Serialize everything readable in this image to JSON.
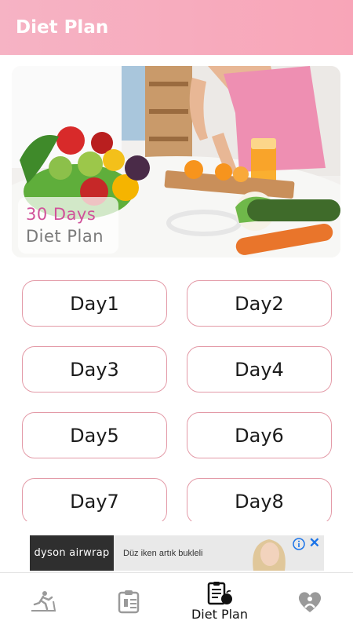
{
  "app_bar": {
    "title": "Diet Plan"
  },
  "banner": {
    "line1": "30 Days",
    "line2": "Diet Plan"
  },
  "days": [
    {
      "label": "Day1"
    },
    {
      "label": "Day2"
    },
    {
      "label": "Day3"
    },
    {
      "label": "Day4"
    },
    {
      "label": "Day5"
    },
    {
      "label": "Day6"
    },
    {
      "label": "Day7"
    },
    {
      "label": "Day8"
    }
  ],
  "ad": {
    "brand": "dyson airwrap",
    "text": "Düz iken artık bukleli",
    "close_glyph": "✕"
  },
  "bottom_nav": {
    "items": [
      {
        "icon": "treadmill-icon",
        "label": ""
      },
      {
        "icon": "clipboard-icon",
        "label": ""
      },
      {
        "icon": "diet-plan-icon",
        "label": "Diet Plan",
        "active": true
      },
      {
        "icon": "heart-icon",
        "label": ""
      }
    ]
  },
  "colors": {
    "app_bar": "#f6b3c4",
    "accent_pink": "#d1529a",
    "day_border": "#e39aa7"
  }
}
